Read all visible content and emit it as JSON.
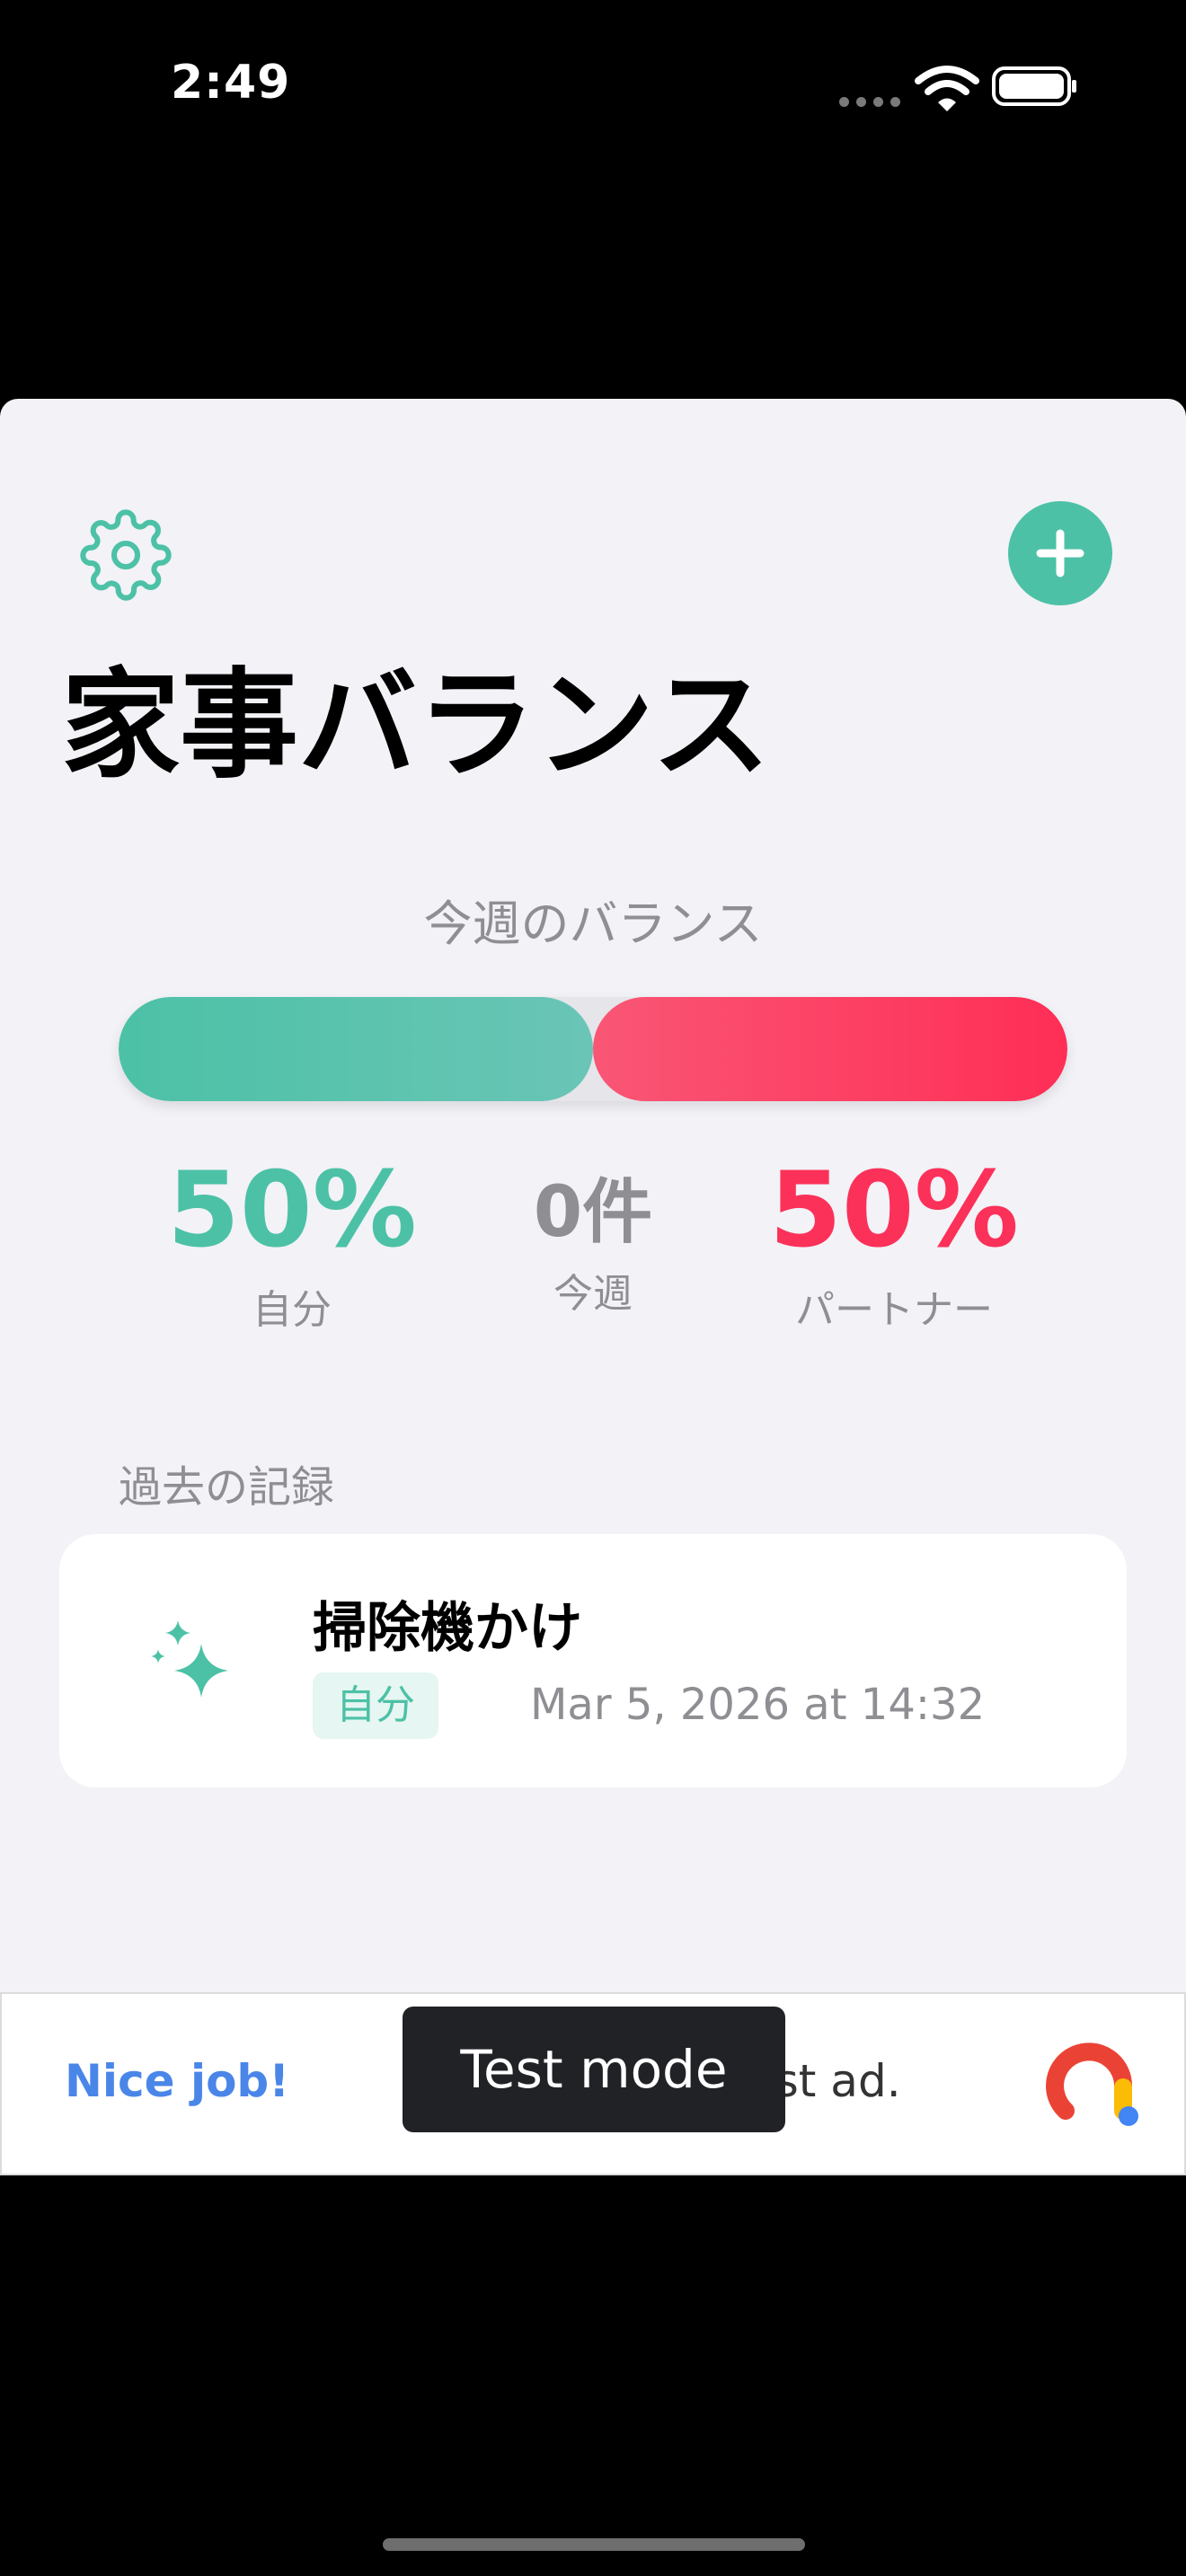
{
  "status_bar": {
    "time": "2:49"
  },
  "header": {
    "settings_icon": "gear-icon",
    "add_icon": "plus-icon",
    "title": "家事バランス"
  },
  "balance": {
    "label": "今週のバランス",
    "self_fraction": 0.5,
    "partner_fraction": 0.5,
    "self_percent": "50%",
    "self_label": "自分",
    "count": "0件",
    "count_label": "今週",
    "partner_percent": "50%",
    "partner_label": "パートナー"
  },
  "history": {
    "heading": "過去の記録",
    "records": [
      {
        "icon": "sparkles-icon",
        "title": "掃除機かけ",
        "badge": "自分",
        "date": "Mar 5, 2026 at 14:32"
      }
    ]
  },
  "ad": {
    "headline": "Nice job!",
    "body": "est ad.",
    "toast": "Test mode"
  },
  "colors": {
    "accent": "#4cc1a6",
    "partner": "#fb3159",
    "background": "#f2f2f7"
  }
}
